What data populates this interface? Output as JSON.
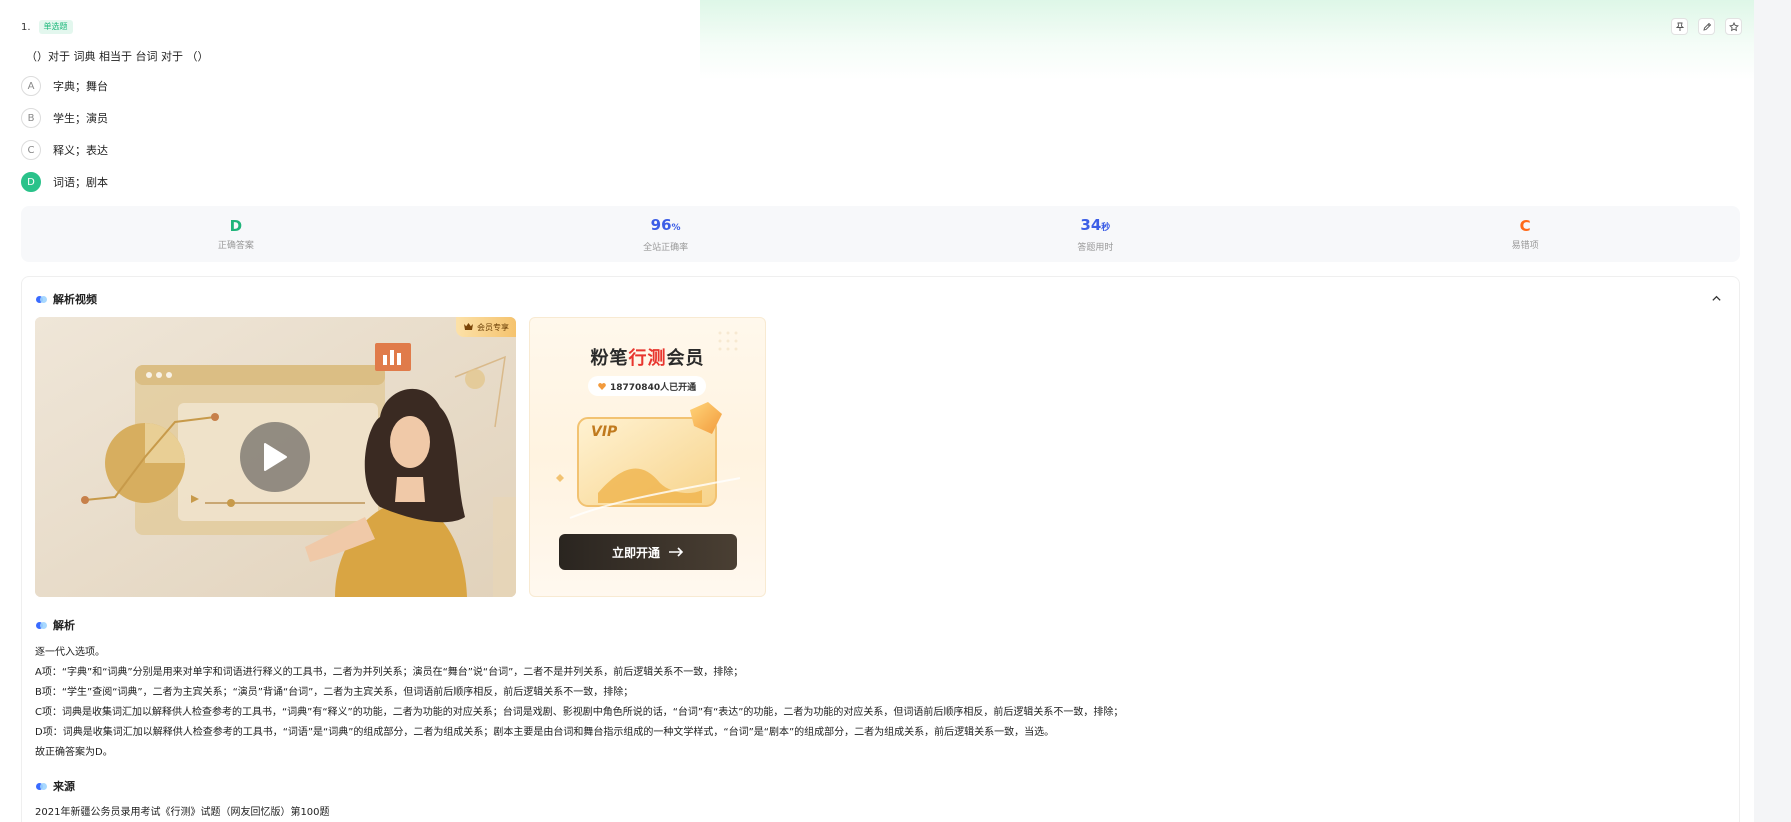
{
  "question": {
    "number": "1.",
    "type": "单选题",
    "stem": "（）对于 词典 相当于 台词 对于 （）",
    "options": [
      {
        "letter": "A",
        "text": "字典；舞台"
      },
      {
        "letter": "B",
        "text": "学生；演员"
      },
      {
        "letter": "C",
        "text": "释义；表达"
      },
      {
        "letter": "D",
        "text": "词语；剧本"
      }
    ],
    "selected": "D"
  },
  "tools": [
    "pin-icon",
    "edit-icon",
    "star-icon"
  ],
  "stats": {
    "correct_answer": {
      "value": "D",
      "label": "正确答案"
    },
    "accuracy": {
      "value": "96",
      "unit": "%",
      "label": "全站正确率"
    },
    "time": {
      "value": "34",
      "unit": "秒",
      "label": "答题用时"
    },
    "common_wrong": {
      "value": "C",
      "label": "易错项"
    }
  },
  "video_section": {
    "title": "解析视频",
    "badge": "会员专享",
    "vip": {
      "title_part1": "粉笔",
      "title_part2": "行测",
      "title_part3": "会员",
      "count": "18770840人已开通",
      "vip_label": "VIP",
      "button": "立即开通"
    }
  },
  "analysis": {
    "title": "解析",
    "lines": [
      "逐一代入选项。",
      "A项：“字典”和“词典”分别是用来对单字和词语进行释义的工具书，二者为并列关系；演员在“舞台”说“台词”，二者不是并列关系，前后逻辑关系不一致，排除；",
      "B项：“学生”查阅“词典”，二者为主宾关系；“演员”背诵“台词”，二者为主宾关系，但词语前后顺序相反，前后逻辑关系不一致，排除；",
      "C项：词典是收集词汇加以解释供人检查参考的工具书，“词典”有“释义”的功能，二者为功能的对应关系；台词是戏剧、影视剧中角色所说的话，“台词”有“表达”的功能，二者为功能的对应关系，但词语前后顺序相反，前后逻辑关系不一致，排除；",
      "D项：词典是收集词汇加以解释供人检查参考的工具书，“词语”是“词典”的组成部分，二者为组成关系；剧本主要是由台词和舞台指示组成的一种文学样式，“台词”是“剧本”的组成部分，二者为组成关系，前后逻辑关系一致，当选。",
      "故正确答案为D。"
    ]
  },
  "source": {
    "title": "来源",
    "text": "2021年新疆公务员录用考试《行测》试题（网友回忆版）第100题"
  },
  "colors": {
    "green": "#1fb47a",
    "blue": "#3c5ee6",
    "orange": "#ff6a1a",
    "selected": "#2ac28a"
  }
}
